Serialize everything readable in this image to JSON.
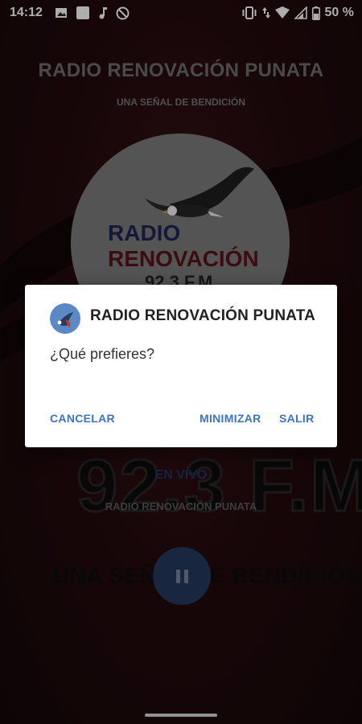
{
  "status_bar": {
    "time": "14:12",
    "battery_percent": "50 %",
    "left_icons": [
      "image-icon",
      "square-icon",
      "music-note-icon",
      "circle-slash-icon"
    ],
    "right_icons": [
      "vibrate-icon",
      "data-arrows-icon",
      "wifi-icon",
      "signal-icon",
      "battery-icon"
    ]
  },
  "header": {
    "title": "RADIO RENOVACIÓN PUNATA",
    "subtitle": "UNA SEÑAL DE BENDICIÓN"
  },
  "logo": {
    "line1": "RADIO",
    "line2": "RENOVACIÓN",
    "line3": "92.3 F.M"
  },
  "player": {
    "big_frequency": "92.3 F.M",
    "live_label": "EN VIVO",
    "station_label": "RADIO RENOVACIÓN PUNATA",
    "slogan": "UNA SEÑAL DE BENDICIÓN"
  },
  "dialog": {
    "title": "RADIO RENOVACIÓN PUNATA",
    "message": "¿Qué prefieres?",
    "buttons": {
      "cancel": "CANCELAR",
      "minimize": "MINIMIZAR",
      "exit": "SALIR"
    }
  },
  "colors": {
    "dialog_button": "#3b74c6",
    "pause_button": "#24395f",
    "live_label": "#1f3466",
    "background": "#240b0e"
  }
}
